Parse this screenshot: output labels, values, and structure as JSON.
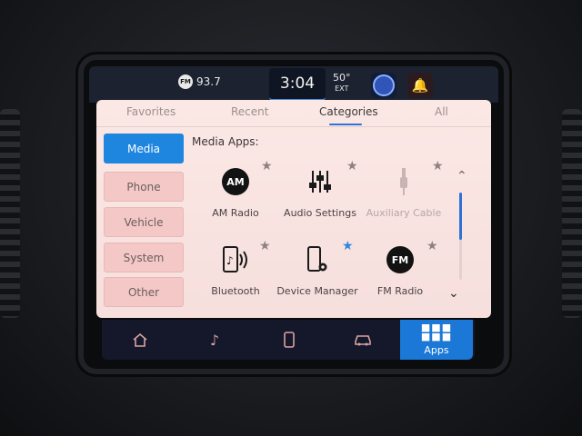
{
  "status_bar": {
    "radio_badge": "FM",
    "radio_station": "93.7",
    "time": "3:04",
    "temperature": "50°",
    "temperature_label": "EXT"
  },
  "tabs": [
    {
      "label": "Favorites",
      "active": false
    },
    {
      "label": "Recent",
      "active": false
    },
    {
      "label": "Categories",
      "active": true
    },
    {
      "label": "All",
      "active": false
    }
  ],
  "categories": [
    {
      "label": "Media",
      "active": true
    },
    {
      "label": "Phone",
      "active": false
    },
    {
      "label": "Vehicle",
      "active": false
    },
    {
      "label": "System",
      "active": false
    },
    {
      "label": "Other",
      "active": false
    }
  ],
  "section_title": "Media Apps:",
  "apps": [
    {
      "label": "AM Radio",
      "icon": "am-radio-icon",
      "icon_text": "AM",
      "favorite": false,
      "enabled": true
    },
    {
      "label": "Audio Settings",
      "icon": "equalizer-icon",
      "favorite": false,
      "enabled": true
    },
    {
      "label": "Auxiliary Cable",
      "icon": "aux-cable-icon",
      "favorite": false,
      "enabled": false
    },
    {
      "label": "Bluetooth",
      "icon": "bluetooth-audio-icon",
      "favorite": false,
      "enabled": true
    },
    {
      "label": "Device Manager",
      "icon": "device-manager-icon",
      "favorite": true,
      "enabled": true
    },
    {
      "label": "FM Radio",
      "icon": "fm-radio-icon",
      "icon_text": "FM",
      "favorite": false,
      "enabled": true
    }
  ],
  "bottom_nav": {
    "apps_label": "Apps"
  },
  "colors": {
    "accent": "#1f86e0",
    "panel": "#fbe8e5",
    "status_bar": "#1c2230"
  }
}
